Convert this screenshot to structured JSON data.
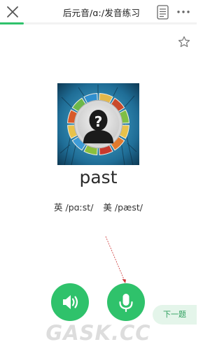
{
  "header": {
    "title": "后元音/ɑ:/发音练习",
    "close_icon": "close-icon",
    "document_icon": "document-icon",
    "more_icon": "more-icon"
  },
  "progress": {
    "fraction": 0.12,
    "color": "#2fc26b"
  },
  "favorite_icon": "star-outline-icon",
  "word_card": {
    "image_icon": "mystery-person-icon",
    "word": "past",
    "phonetic_uk": "英 /pɑːst/",
    "phonetic_us": "美 /pæst/"
  },
  "controls": {
    "play_icon": "speaker-icon",
    "record_icon": "microphone-icon",
    "next_label": "下一题"
  },
  "watermark": "GASK.CC",
  "colors": {
    "accent": "#2fc26b",
    "next_bg": "#e4f5ea",
    "annotation": "#cc3333"
  }
}
